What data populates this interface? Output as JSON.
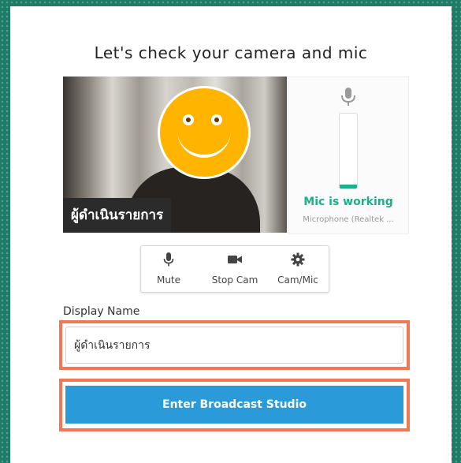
{
  "modal": {
    "title": "Let's check your camera and mic"
  },
  "video": {
    "name_tag": "ผู้ดำเนินรายการ"
  },
  "mic": {
    "status": "Mic is working",
    "device": "Microphone (Realtek ...",
    "level": 0.05,
    "accent_color": "#1fae8a"
  },
  "controls": [
    {
      "icon": "mic-icon",
      "label": "Mute"
    },
    {
      "icon": "video-camera-icon",
      "label": "Stop Cam"
    },
    {
      "icon": "gear-icon",
      "label": "Cam/Mic"
    }
  ],
  "form": {
    "display_name_label": "Display Name",
    "display_name_value": "ผู้ดำเนินรายการ",
    "enter_button": "Enter Broadcast Studio",
    "button_color": "#2a9ad8",
    "highlight_color": "#f07854"
  }
}
